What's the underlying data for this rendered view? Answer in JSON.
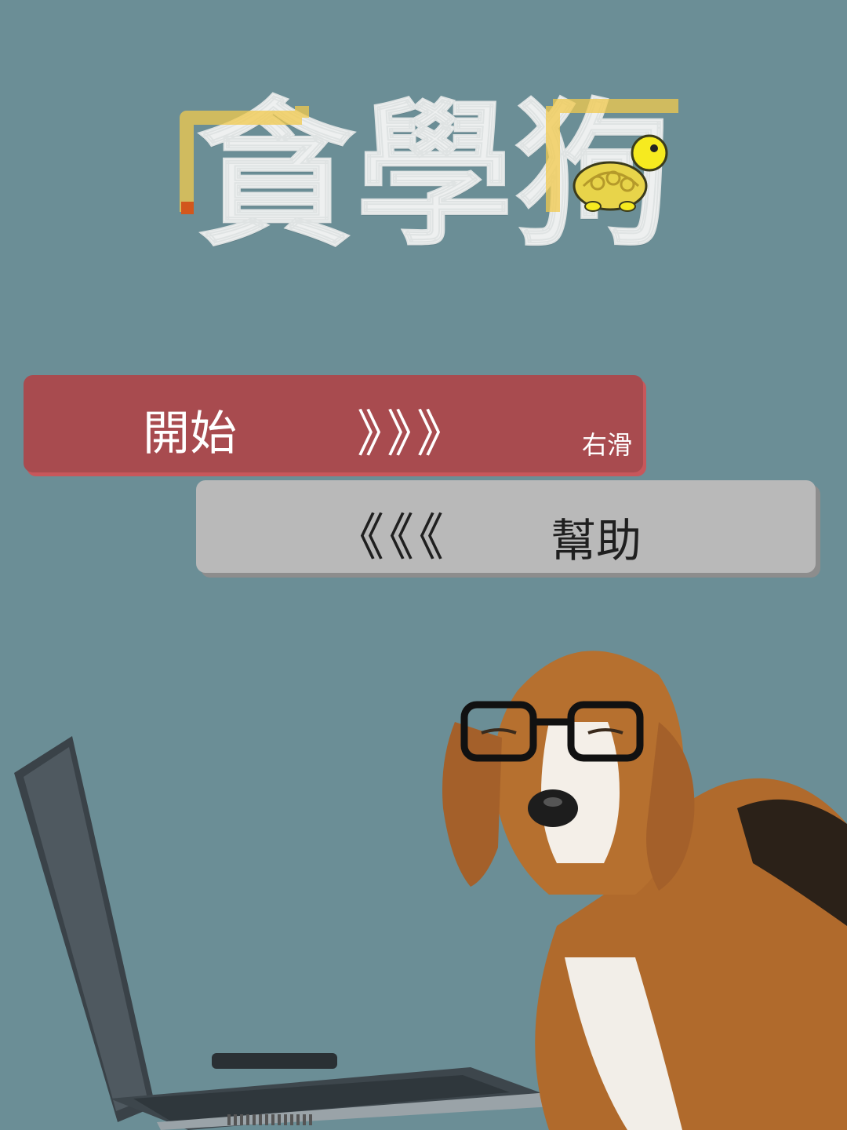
{
  "app": {
    "title": "貪學狗"
  },
  "menu": {
    "start_label": "開始",
    "start_arrows": "》》》",
    "start_hint": "右滑",
    "help_arrows": "《《《",
    "help_label": "幫助"
  },
  "colors": {
    "background": "#6b8e96",
    "start_button": "#a84b4f",
    "help_button": "#b9b9b9",
    "logo_text": "#eef0f0",
    "snake_trail": "#f2c94c"
  },
  "icons": {
    "mascot": "turtle-icon",
    "illustration_laptop": "laptop-illustration",
    "illustration_dog": "beagle-with-glasses-illustration"
  }
}
